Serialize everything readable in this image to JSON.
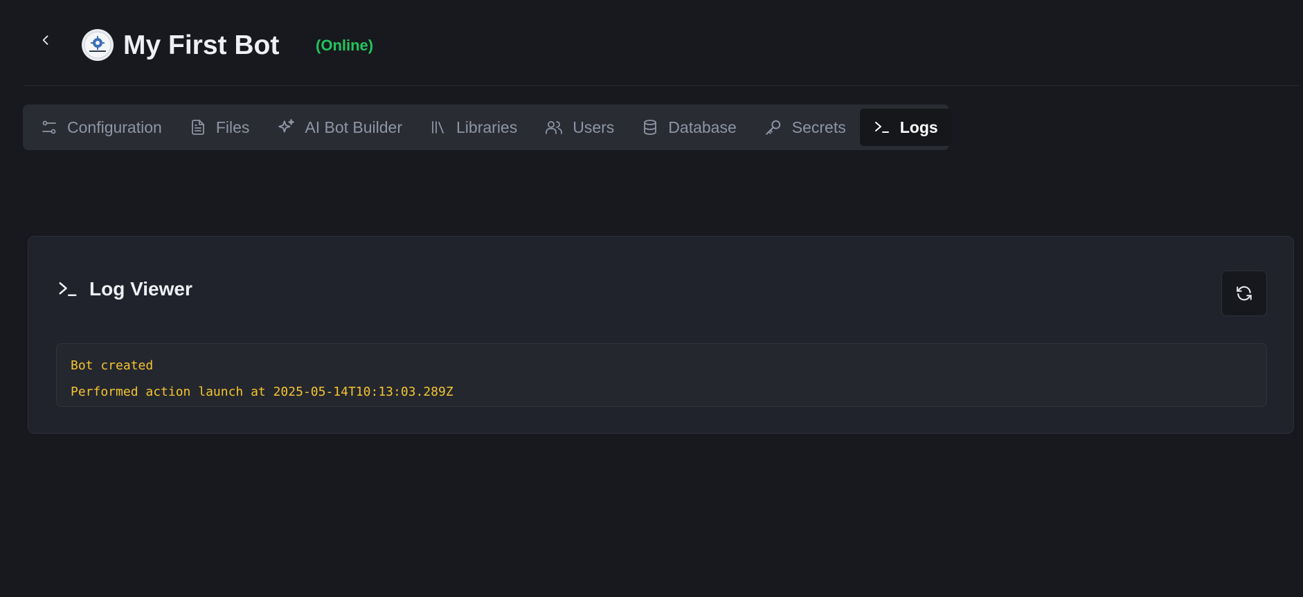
{
  "header": {
    "title": "My First Bot",
    "status": "(Online)",
    "status_color": "#22c55e",
    "back_icon": "chevron-left-icon",
    "avatar_icon": "bot-logo-icon"
  },
  "tabs": [
    {
      "label": "Configuration",
      "icon": "sliders-icon",
      "active": false
    },
    {
      "label": "Files",
      "icon": "file-text-icon",
      "active": false
    },
    {
      "label": "AI Bot Builder",
      "icon": "sparkles-icon",
      "active": false
    },
    {
      "label": "Libraries",
      "icon": "library-icon",
      "active": false
    },
    {
      "label": "Users",
      "icon": "users-icon",
      "active": false
    },
    {
      "label": "Database",
      "icon": "database-icon",
      "active": false
    },
    {
      "label": "Secrets",
      "icon": "key-icon",
      "active": false
    },
    {
      "label": "Logs",
      "icon": "terminal-icon",
      "active": true
    }
  ],
  "log_viewer": {
    "title": "Log Viewer",
    "title_icon": "terminal-icon",
    "refresh_icon": "refresh-icon",
    "lines": [
      "Bot created",
      "Performed action launch at 2025-05-14T10:13:03.289Z"
    ],
    "log_color": "#f5c431"
  }
}
